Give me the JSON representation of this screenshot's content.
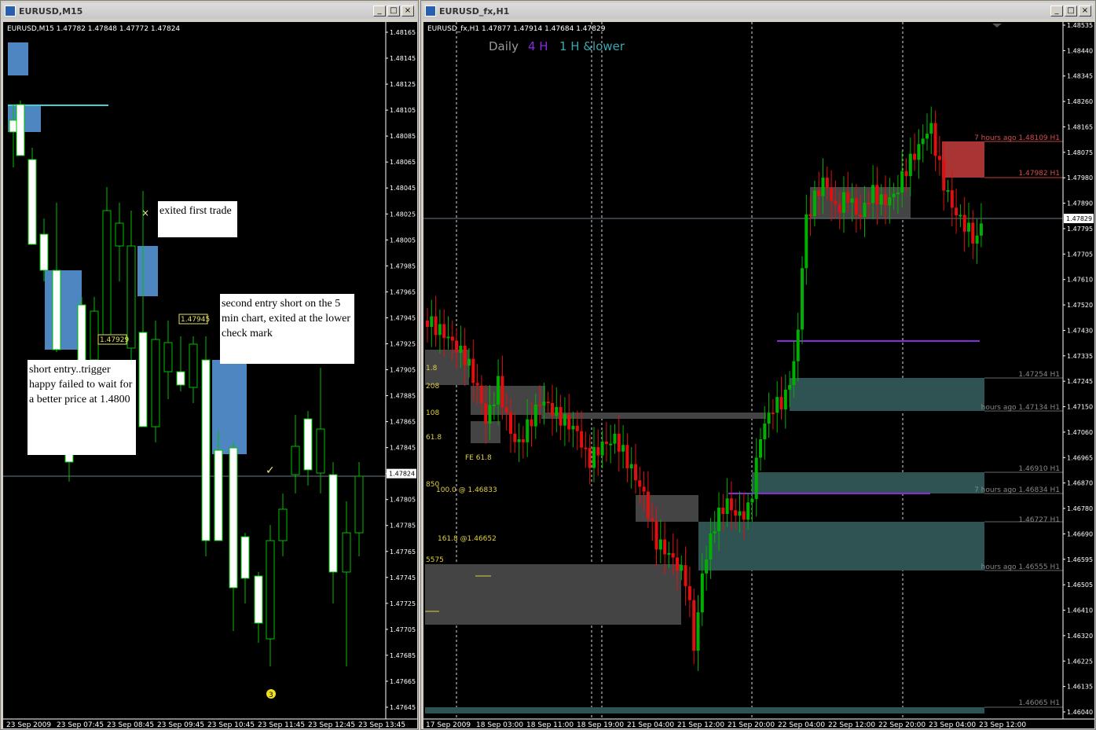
{
  "left": {
    "window_title": "EURUSD,M15",
    "header": "EURUSD,M15  1.47782 1.47848 1.47772 1.47824",
    "price_labels": [
      "1.48165",
      "1.48145",
      "1.48125",
      "1.48105",
      "1.48085",
      "1.48065",
      "1.48045",
      "1.48025",
      "1.48005",
      "1.47985",
      "1.47965",
      "1.47945",
      "1.47925",
      "1.47905",
      "1.47885",
      "1.47865",
      "1.47845",
      "1.47824",
      "1.47805",
      "1.47785",
      "1.47765",
      "1.47745",
      "1.47725",
      "1.47705",
      "1.47685",
      "1.47665",
      "1.47645"
    ],
    "current_price": "1.47824",
    "time_labels": [
      "23 Sep 2009",
      "23 Sep 07:45",
      "23 Sep 08:45",
      "23 Sep 09:45",
      "23 Sep 10:45",
      "23 Sep 11:45",
      "23 Sep 12:45",
      "23 Sep 13:45"
    ],
    "tag_1": "1.47945",
    "tag_2": "1.47929",
    "note_1": "exited first trade",
    "note_2": "second entry short on the 5 min chart, exited at the lower check mark",
    "note_3": "short entry..trigger happy failed to wait for a better price at 1.4800",
    "marker": "3",
    "check": "✓",
    "x_mark": "×"
  },
  "right": {
    "window_title": "EURUSD_fx,H1",
    "header": "EURUSD_fx,H1  1.47877 1.47914 1.47684 1.47829",
    "legend_daily": "Daily",
    "legend_4h": "4 H",
    "legend_1h": "1 H &lower",
    "price_labels": [
      "1.48535",
      "1.48440",
      "1.48345",
      "1.48260",
      "1.48165",
      "1.48075",
      "1.47980",
      "1.47890",
      "1.47795",
      "1.47705",
      "1.47610",
      "1.47520",
      "1.47430",
      "1.47335",
      "1.47245",
      "1.47150",
      "1.47060",
      "1.46965",
      "1.46870",
      "1.46780",
      "1.46690",
      "1.46595",
      "1.46505",
      "1.46410",
      "1.46320",
      "1.46225",
      "1.46135",
      "1.46040"
    ],
    "current_price": "1.47829",
    "time_labels": [
      "17 Sep 2009",
      "18 Sep 03:00",
      "18 Sep 11:00",
      "18 Sep 19:00",
      "21 Sep 04:00",
      "21 Sep 12:00",
      "21 Sep 20:00",
      "22 Sep 04:00",
      "22 Sep 12:00",
      "22 Sep 20:00",
      "23 Sep 04:00",
      "23 Sep 12:00"
    ],
    "zone_labels": [
      "7 hours ago 1.48109 H1",
      "1.47982 H1",
      "1.47254 H1",
      "hours ago 1.47134 H1",
      "1.46910 H1",
      "7 hours ago 1.46834 H1",
      "1.46727 H1",
      "hours ago 1.46555 H1",
      "1.46065 H1"
    ],
    "fib_labels": [
      "1.8",
      "208",
      "108",
      "61.8",
      "FE 61.8",
      "850",
      "100.0 @ 1.46833",
      "161.8 @1.46652",
      "5575"
    ]
  },
  "colors": {
    "bull": "#00b000",
    "bear": "#e01010",
    "zone_blue": "#4d86c0",
    "zone_teal": "#2f5252",
    "zone_grey": "#444444",
    "zone_red": "#a83434",
    "purple": "#8a2be2"
  }
}
